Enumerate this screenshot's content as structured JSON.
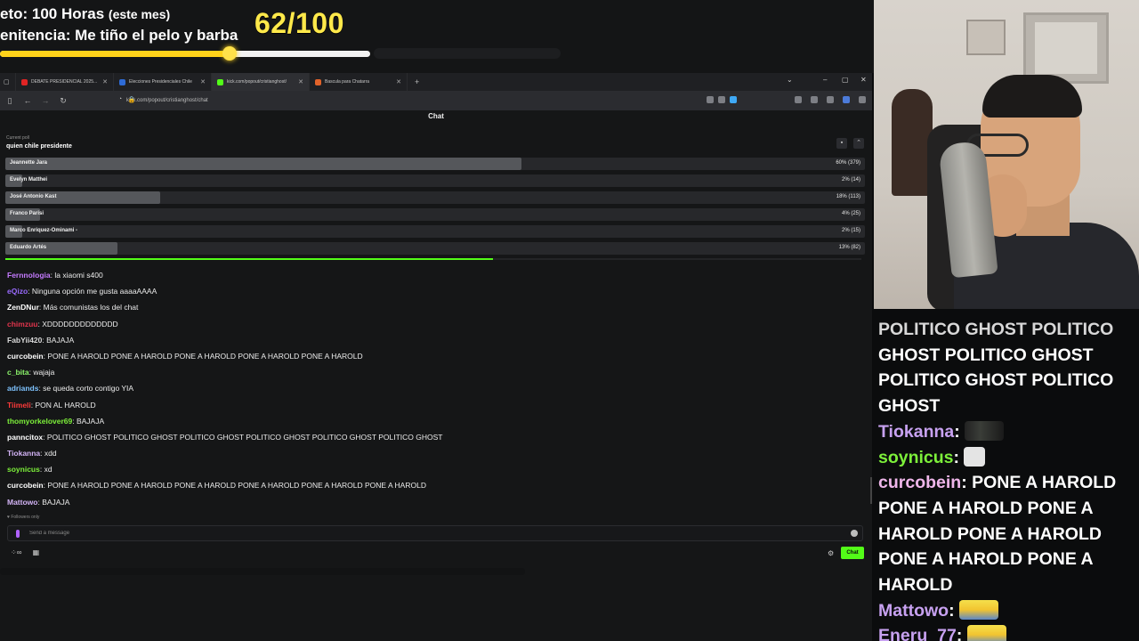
{
  "overlay": {
    "goal_line1": "eto: 100 Horas",
    "goal_line1_small": "(este mes)",
    "goal_line2": "enitencia: Me tiño el pelo y barba",
    "goal_count": "62/100",
    "goal_progress": 0.62
  },
  "browser": {
    "tabs": [
      {
        "label": "DEBATE PRESIDENCIAL 2025...",
        "favicon_color": "#e02424",
        "active": false
      },
      {
        "label": "Elecciones Presidenciales Chile",
        "favicon_color": "#2e6bd6",
        "active": false
      },
      {
        "label": "kick.com/popout/cristianghost/",
        "favicon_color": "#53fc18",
        "active": true
      },
      {
        "label": "Bascula para Chatarra",
        "favicon_color": "#e2632a",
        "active": false
      }
    ],
    "new_tab": "+",
    "url": "kick.com/popout/cristianghost/chat"
  },
  "chat": {
    "title": "Chat",
    "poll": {
      "label": "Current poll",
      "question": "quien chile presidente",
      "options": [
        {
          "name": "Jeannette Jara",
          "result": "60% (379)",
          "fraction": 0.6
        },
        {
          "name": "Evelyn Matthei",
          "result": "2% (14)",
          "fraction": 0.02
        },
        {
          "name": "José Antonio Kast",
          "result": "18% (113)",
          "fraction": 0.18
        },
        {
          "name": "Franco Parisi",
          "result": "4% (25)",
          "fraction": 0.04
        },
        {
          "name": "Marco Enriquez-Ominami -",
          "result": "2% (15)",
          "fraction": 0.02
        },
        {
          "name": "Eduardo Artés",
          "result": "13% (82)",
          "fraction": 0.13
        }
      ],
      "timer_remaining": 0.57
    },
    "messages": [
      {
        "user": "Fernnologia",
        "color": "#c57bff",
        "text": "la xiaomi s400"
      },
      {
        "user": "eQizo",
        "color": "#9a6bff",
        "text": "Ninguna opción me gusta aaaaAAAA"
      },
      {
        "user": "ZenDNur",
        "color": "#ffffff",
        "text": "Más comunistas los del chat"
      },
      {
        "user": "chimzuu",
        "color": "#e0344c",
        "text": "XDDDDDDDDDDDDD"
      },
      {
        "user": "FabYii420",
        "color": "#d8d8d8",
        "text": "BAJAJA"
      },
      {
        "user": "curcobein",
        "color": "#ffffff",
        "text": "PONE A HAROLD PONE A HAROLD PONE A HAROLD PONE A HAROLD PONE A HAROLD"
      },
      {
        "user": "c_bita",
        "color": "#8cf56b",
        "text": "wajaja"
      },
      {
        "user": "adriands",
        "color": "#7ec3ff",
        "text": "se queda corto contigo YIA"
      },
      {
        "user": "Tiimeli",
        "color": "#ff3a3a",
        "text": "PON AL HAROLD"
      },
      {
        "user": "thomyorkelover69",
        "color": "#7df03a",
        "text": "BAJAJA"
      },
      {
        "user": "panncitox",
        "color": "#ffffff",
        "text": "POLITICO GHOST POLITICO GHOST POLITICO GHOST POLITICO GHOST POLITICO GHOST POLITICO GHOST"
      },
      {
        "user": "Tiokanna",
        "color": "#d2b3f5",
        "text": "xdd"
      },
      {
        "user": "soynicus",
        "color": "#7df03a",
        "text": "xd"
      },
      {
        "user": "curcobein",
        "color": "#ffffff",
        "text": "PONE A HAROLD PONE A HAROLD PONE A HAROLD PONE A HAROLD PONE A HAROLD PONE A HAROLD"
      },
      {
        "user": "Mattowo",
        "color": "#d2b3f5",
        "text": "BAJAJA"
      }
    ],
    "followers_only": "Followers only",
    "send_placeholder": "Send a message",
    "chat_button": "Chat"
  },
  "overlay_chat": {
    "first_line": "POLITICO GHOST POLITICO",
    "continued_text": "GHOST POLITICO GHOST POLITICO GHOST POLITICO GHOST",
    "entries": [
      {
        "user": "Tiokanna",
        "emote": "emote-dark"
      },
      {
        "user": "soynicus",
        "emote": "emote-red"
      },
      {
        "user": "curcobein",
        "text": "PONE A HAROLD PONE A HAROLD PONE A HAROLD PONE A HAROLD PONE A HAROLD PONE A HAROLD"
      },
      {
        "user": "Mattowo",
        "emote": "emote-minion"
      },
      {
        "user": "Eneru_77",
        "emote": "emote-minion"
      }
    ]
  }
}
